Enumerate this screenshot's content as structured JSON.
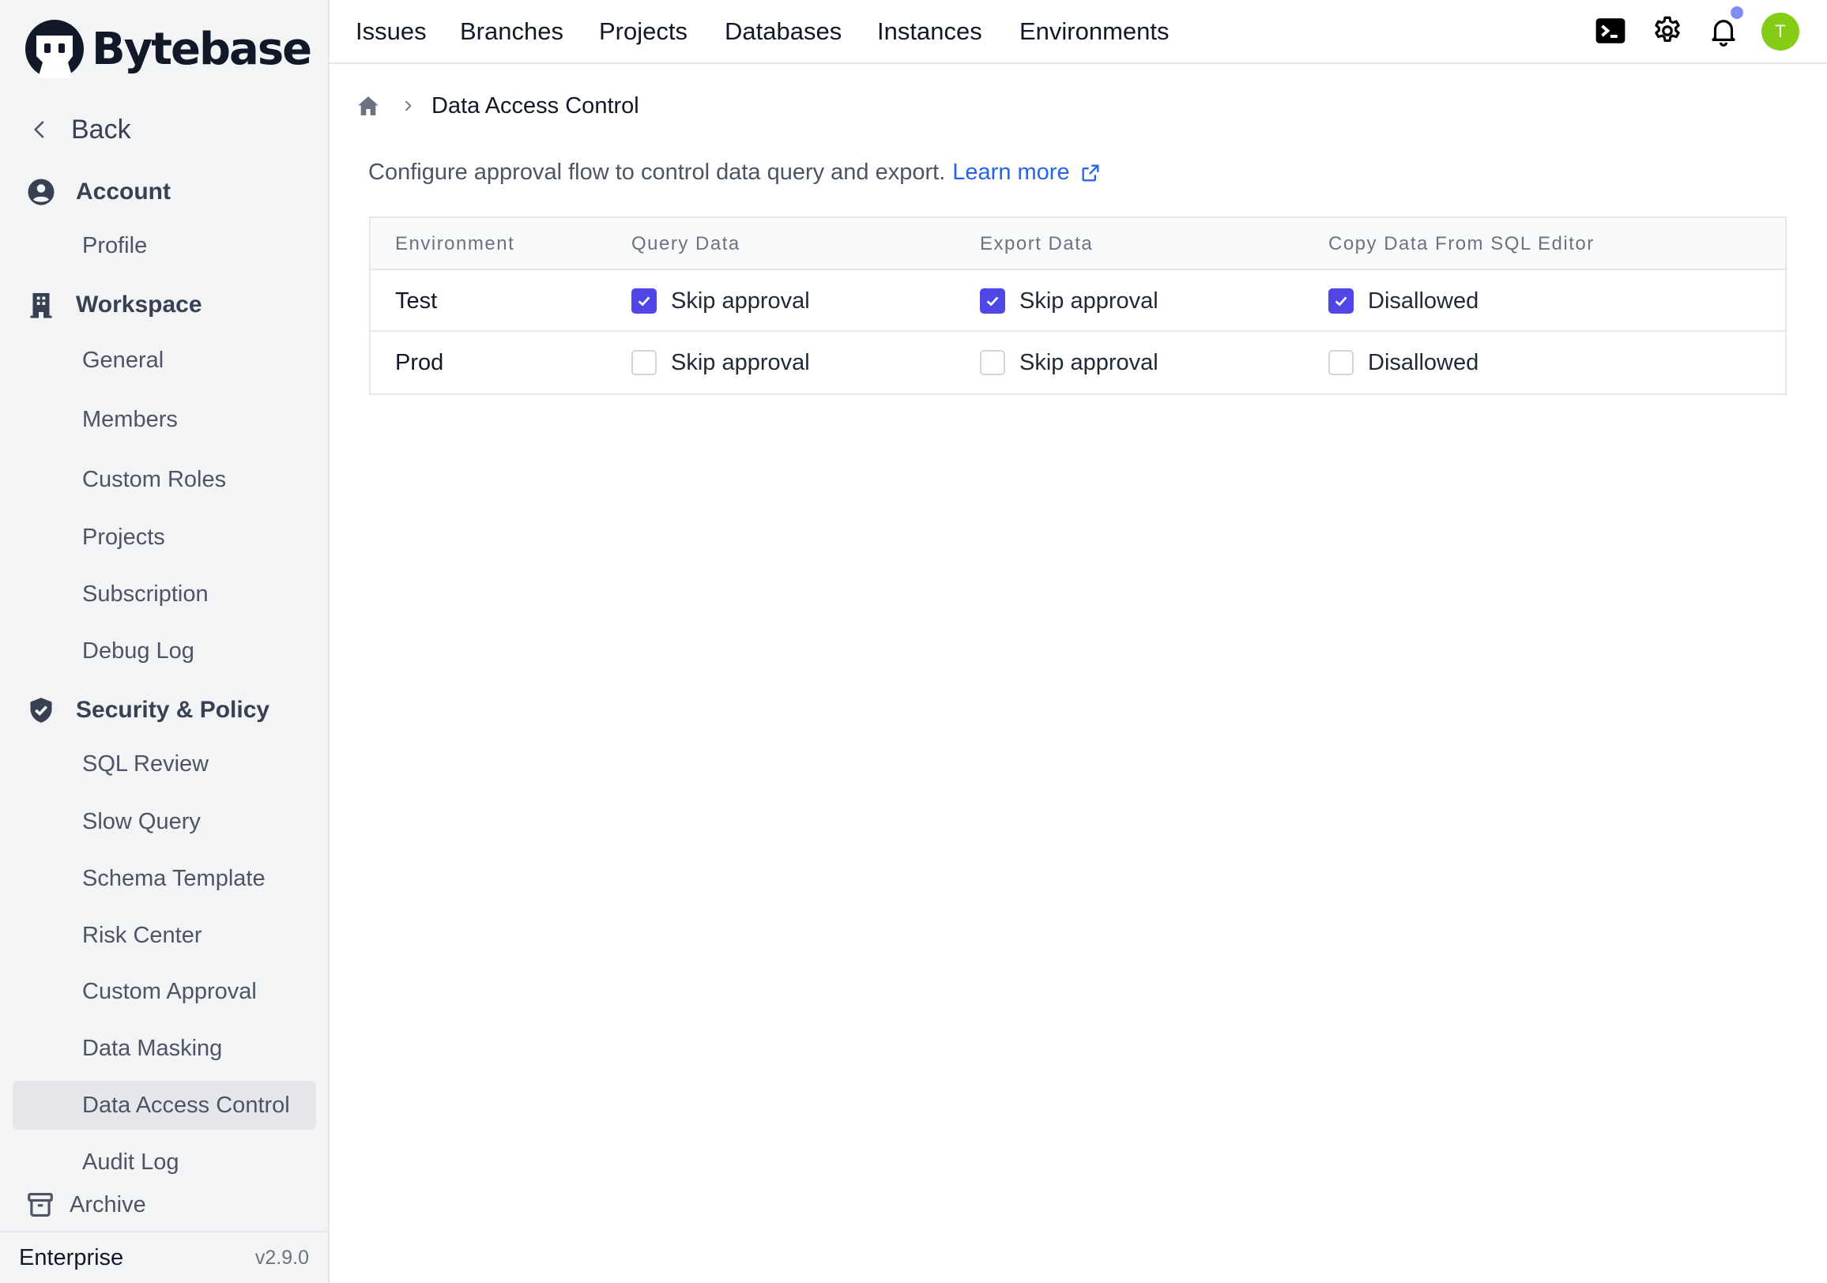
{
  "brand": {
    "name": "Bytebase"
  },
  "sidebar": {
    "back_label": "Back",
    "sections": {
      "account": {
        "label": "Account",
        "icon": "user-circle-icon",
        "items": [
          "Profile"
        ]
      },
      "workspace": {
        "label": "Workspace",
        "icon": "building-icon",
        "items": [
          "General",
          "Members",
          "Custom Roles",
          "Projects",
          "Subscription",
          "Debug Log"
        ]
      },
      "security": {
        "label": "Security & Policy",
        "icon": "shield-check-icon",
        "items": [
          "SQL Review",
          "Slow Query",
          "Schema Template",
          "Risk Center",
          "Custom Approval",
          "Data Masking",
          "Data Access Control",
          "Audit Log"
        ]
      }
    },
    "active_item": "Data Access Control",
    "archive_label": "Archive",
    "footer": {
      "plan": "Enterprise",
      "version": "v2.9.0"
    }
  },
  "header": {
    "nav": [
      "Issues",
      "Branches",
      "Projects",
      "Databases",
      "Instances",
      "Environments"
    ],
    "icons": [
      "terminal-icon",
      "gear-icon",
      "bell-icon"
    ],
    "notification_dot_color": "#818cf8",
    "avatar": {
      "initial": "T",
      "color": "#84cc16"
    }
  },
  "breadcrumb": {
    "current": "Data Access Control"
  },
  "description": {
    "text": "Configure approval flow to control data query and export.",
    "link_label": "Learn more"
  },
  "table": {
    "columns": [
      "Environment",
      "Query Data",
      "Export Data",
      "Copy Data From SQL Editor"
    ],
    "rows": [
      {
        "environment": "Test",
        "query": {
          "label": "Skip approval",
          "checked": true
        },
        "export": {
          "label": "Skip approval",
          "checked": true
        },
        "copy": {
          "label": "Disallowed",
          "checked": true
        }
      },
      {
        "environment": "Prod",
        "query": {
          "label": "Skip approval",
          "checked": false
        },
        "export": {
          "label": "Skip approval",
          "checked": false
        },
        "copy": {
          "label": "Disallowed",
          "checked": false
        }
      }
    ]
  },
  "colors": {
    "accent": "#4f46e5",
    "link": "#2563eb",
    "sidebar_bg": "#f3f4f6"
  }
}
